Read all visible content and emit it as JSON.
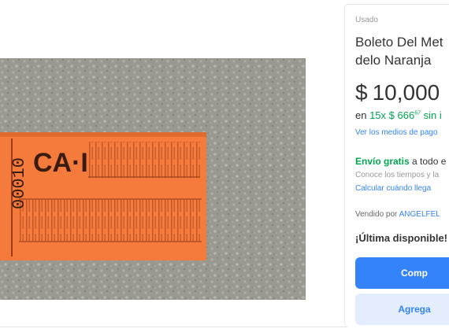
{
  "listing": {
    "condition": "Usado",
    "title_line1": "Boleto Del Met",
    "title_line2": "delo Naranja",
    "price": {
      "currency": "$",
      "amount": "10,000"
    },
    "installments": {
      "prefix": "en ",
      "count": "15x",
      "amount": "$ 666",
      "cents": "67",
      "suffix": " sin i"
    },
    "payment_methods_link": "Ver los medios de pago",
    "shipping": {
      "free_label": "Envío gratis",
      "rest": " a todo e",
      "times_text": "Conoce los tiempos y la",
      "calc_link": "Calcular cuándo llega"
    },
    "seller": {
      "prefix": "Vendido por ",
      "name": "ANGELFEL"
    },
    "stock_text": "¡Última disponible!",
    "buy_button": "Comp",
    "cart_button": "Agrega"
  },
  "photo": {
    "alt_subject": "ticket",
    "ticket_text": "CA·I",
    "ticket_serial": "00010",
    "colors": {
      "ticket": "#f47b3c",
      "ticket_print": "#8a2b14",
      "background": "#9a9a92"
    }
  },
  "colors": {
    "accent": "#3483fa",
    "green": "#00a650",
    "cart_bg": "#e3edfb"
  }
}
